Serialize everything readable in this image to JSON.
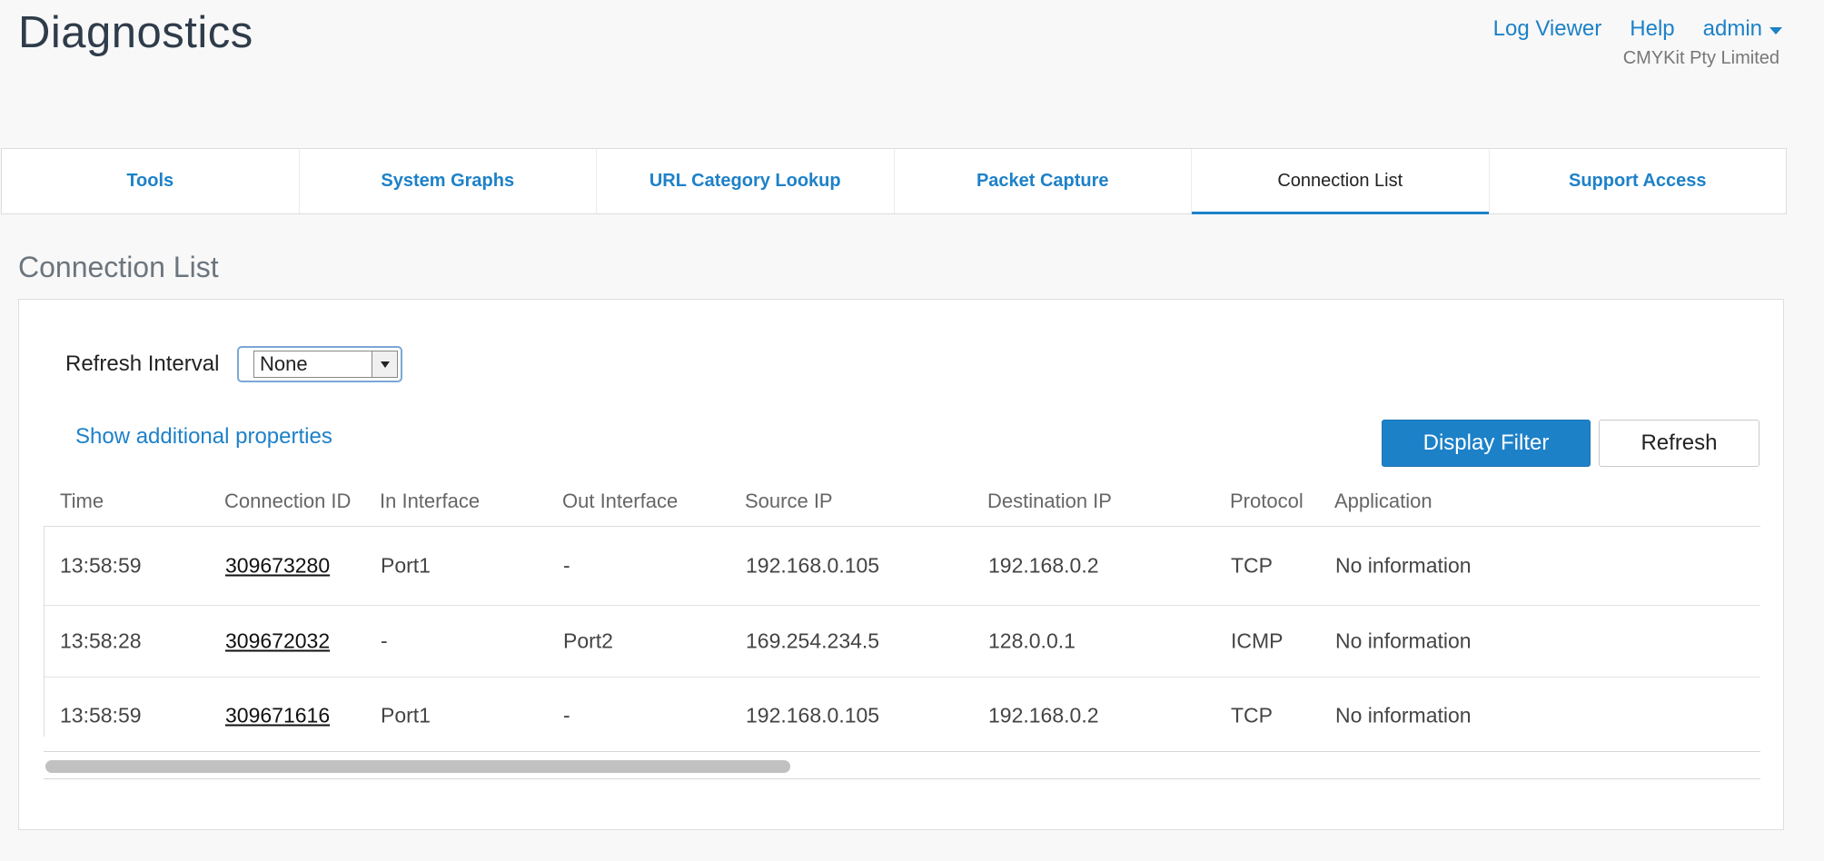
{
  "page": {
    "title": "Diagnostics"
  },
  "topnav": {
    "log_viewer": "Log Viewer",
    "help": "Help",
    "user": "admin",
    "org": "CMYKit Pty Limited"
  },
  "tabs": [
    {
      "label": "Tools",
      "active": false
    },
    {
      "label": "System Graphs",
      "active": false
    },
    {
      "label": "URL Category Lookup",
      "active": false
    },
    {
      "label": "Packet Capture",
      "active": false
    },
    {
      "label": "Connection List",
      "active": true
    },
    {
      "label": "Support Access",
      "active": false
    }
  ],
  "section": {
    "title": "Connection List"
  },
  "controls": {
    "refresh_interval_label": "Refresh Interval",
    "refresh_interval_value": "None",
    "show_additional": "Show additional properties",
    "display_filter": "Display Filter",
    "refresh": "Refresh"
  },
  "table": {
    "columns": [
      "Time",
      "Connection ID",
      "In Interface",
      "Out Interface",
      "Source IP",
      "Destination IP",
      "Protocol",
      "Application"
    ],
    "rows": [
      [
        "13:58:59",
        "309673280",
        "Port1",
        "-",
        "192.168.0.105",
        "192.168.0.2",
        "TCP",
        "No information"
      ],
      [
        "13:58:28",
        "309672032",
        "-",
        "Port2",
        "169.254.234.5",
        "128.0.0.1",
        "ICMP",
        "No information"
      ],
      [
        "13:58:59",
        "309671616",
        "Port1",
        "-",
        "192.168.0.105",
        "192.168.0.2",
        "TCP",
        "No information"
      ]
    ]
  },
  "colors": {
    "accent": "#1d81c8",
    "background": "#f8f8f8"
  }
}
